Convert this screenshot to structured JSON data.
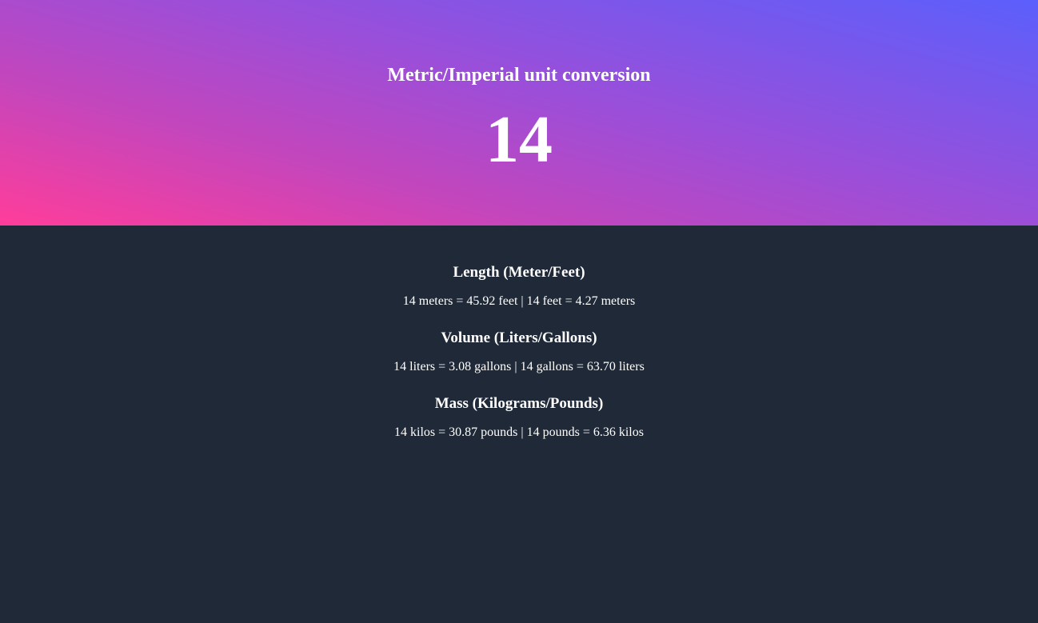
{
  "header": {
    "title": "Metric/Imperial unit conversion",
    "value": "14"
  },
  "sections": [
    {
      "title": "Length (Meter/Feet)",
      "text": "14 meters = 45.92 feet | 14 feet = 4.27 meters"
    },
    {
      "title": "Volume (Liters/Gallons)",
      "text": "14 liters = 3.08 gallons | 14 gallons = 63.70 liters"
    },
    {
      "title": "Mass (Kilograms/Pounds)",
      "text": "14 kilos = 30.87 pounds | 14 pounds = 6.36 kilos"
    }
  ],
  "colors": {
    "background": "#1f2937",
    "gradient_start": "#ff3d9a",
    "gradient_end": "#5b5ffc",
    "text": "#ffffff"
  }
}
